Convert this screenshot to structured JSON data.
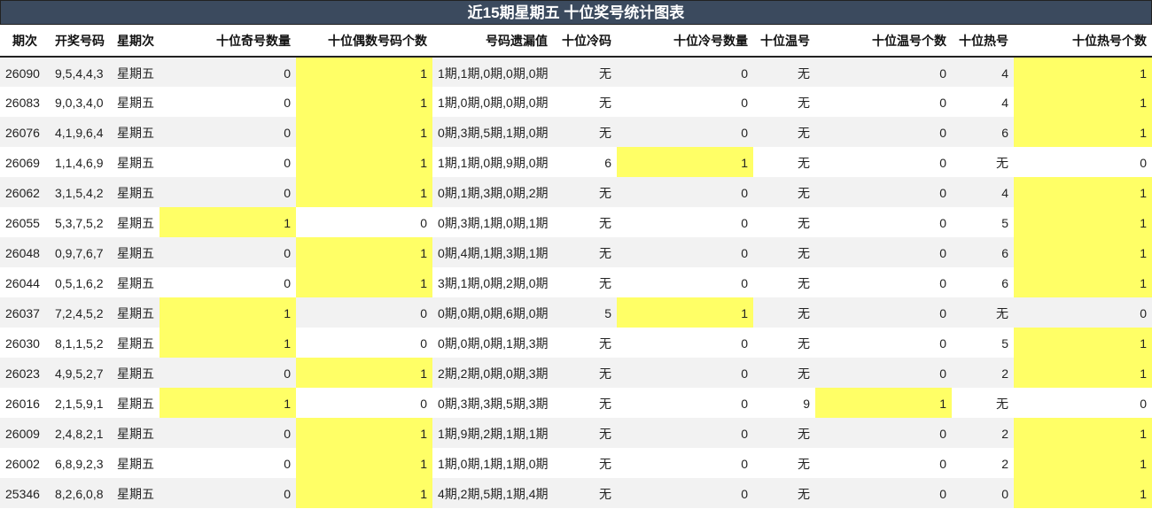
{
  "title": "近15期星期五 十位奖号统计图表",
  "headers": [
    "期次",
    "开奖号码",
    "星期次",
    "十位奇号数量",
    "十位偶数号码个数",
    "号码遗漏值",
    "十位冷码",
    "十位冷号数量",
    "十位温号",
    "十位温号个数",
    "十位热号",
    "十位热号个数"
  ],
  "highlight_color": "#ffff66",
  "rows": [
    {
      "issue": "26090",
      "numbers": "9,5,4,4,3",
      "weekday": "星期五",
      "odd_count": "0",
      "even_count": "1",
      "miss": "1期,1期,0期,0期,0期",
      "cold": "无",
      "cold_count": "0",
      "warm": "无",
      "warm_count": "0",
      "hot": "4",
      "hot_count": "1",
      "hl": [
        5,
        12
      ]
    },
    {
      "issue": "26083",
      "numbers": "9,0,3,4,0",
      "weekday": "星期五",
      "odd_count": "0",
      "even_count": "1",
      "miss": "1期,0期,0期,0期,0期",
      "cold": "无",
      "cold_count": "0",
      "warm": "无",
      "warm_count": "0",
      "hot": "4",
      "hot_count": "1",
      "hl": [
        5,
        12
      ]
    },
    {
      "issue": "26076",
      "numbers": "4,1,9,6,4",
      "weekday": "星期五",
      "odd_count": "0",
      "even_count": "1",
      "miss": "0期,3期,5期,1期,0期",
      "cold": "无",
      "cold_count": "0",
      "warm": "无",
      "warm_count": "0",
      "hot": "6",
      "hot_count": "1",
      "hl": [
        5,
        12
      ]
    },
    {
      "issue": "26069",
      "numbers": "1,1,4,6,9",
      "weekday": "星期五",
      "odd_count": "0",
      "even_count": "1",
      "miss": "1期,1期,0期,9期,0期",
      "cold": "6",
      "cold_count": "1",
      "warm": "无",
      "warm_count": "0",
      "hot": "无",
      "hot_count": "0",
      "hl": [
        5,
        8
      ]
    },
    {
      "issue": "26062",
      "numbers": "3,1,5,4,2",
      "weekday": "星期五",
      "odd_count": "0",
      "even_count": "1",
      "miss": "0期,1期,3期,0期,2期",
      "cold": "无",
      "cold_count": "0",
      "warm": "无",
      "warm_count": "0",
      "hot": "4",
      "hot_count": "1",
      "hl": [
        5,
        12
      ]
    },
    {
      "issue": "26055",
      "numbers": "5,3,7,5,2",
      "weekday": "星期五",
      "odd_count": "1",
      "even_count": "0",
      "miss": "0期,3期,1期,0期,1期",
      "cold": "无",
      "cold_count": "0",
      "warm": "无",
      "warm_count": "0",
      "hot": "5",
      "hot_count": "1",
      "hl": [
        4,
        12
      ]
    },
    {
      "issue": "26048",
      "numbers": "0,9,7,6,7",
      "weekday": "星期五",
      "odd_count": "0",
      "even_count": "1",
      "miss": "0期,4期,1期,3期,1期",
      "cold": "无",
      "cold_count": "0",
      "warm": "无",
      "warm_count": "0",
      "hot": "6",
      "hot_count": "1",
      "hl": [
        5,
        12
      ]
    },
    {
      "issue": "26044",
      "numbers": "0,5,1,6,2",
      "weekday": "星期五",
      "odd_count": "0",
      "even_count": "1",
      "miss": "3期,1期,0期,2期,0期",
      "cold": "无",
      "cold_count": "0",
      "warm": "无",
      "warm_count": "0",
      "hot": "6",
      "hot_count": "1",
      "hl": [
        5,
        12
      ]
    },
    {
      "issue": "26037",
      "numbers": "7,2,4,5,2",
      "weekday": "星期五",
      "odd_count": "1",
      "even_count": "0",
      "miss": "0期,0期,0期,6期,0期",
      "cold": "5",
      "cold_count": "1",
      "warm": "无",
      "warm_count": "0",
      "hot": "无",
      "hot_count": "0",
      "hl": [
        4,
        8
      ]
    },
    {
      "issue": "26030",
      "numbers": "8,1,1,5,2",
      "weekday": "星期五",
      "odd_count": "1",
      "even_count": "0",
      "miss": "0期,0期,0期,1期,3期",
      "cold": "无",
      "cold_count": "0",
      "warm": "无",
      "warm_count": "0",
      "hot": "5",
      "hot_count": "1",
      "hl": [
        4,
        12
      ]
    },
    {
      "issue": "26023",
      "numbers": "4,9,5,2,7",
      "weekday": "星期五",
      "odd_count": "0",
      "even_count": "1",
      "miss": "2期,2期,0期,0期,3期",
      "cold": "无",
      "cold_count": "0",
      "warm": "无",
      "warm_count": "0",
      "hot": "2",
      "hot_count": "1",
      "hl": [
        5,
        12
      ]
    },
    {
      "issue": "26016",
      "numbers": "2,1,5,9,1",
      "weekday": "星期五",
      "odd_count": "1",
      "even_count": "0",
      "miss": "0期,3期,3期,5期,3期",
      "cold": "无",
      "cold_count": "0",
      "warm": "9",
      "warm_count": "1",
      "hot": "无",
      "hot_count": "0",
      "hl": [
        4,
        10
      ]
    },
    {
      "issue": "26009",
      "numbers": "2,4,8,2,1",
      "weekday": "星期五",
      "odd_count": "0",
      "even_count": "1",
      "miss": "1期,9期,2期,1期,1期",
      "cold": "无",
      "cold_count": "0",
      "warm": "无",
      "warm_count": "0",
      "hot": "2",
      "hot_count": "1",
      "hl": [
        5,
        12
      ]
    },
    {
      "issue": "26002",
      "numbers": "6,8,9,2,3",
      "weekday": "星期五",
      "odd_count": "0",
      "even_count": "1",
      "miss": "1期,0期,1期,1期,0期",
      "cold": "无",
      "cold_count": "0",
      "warm": "无",
      "warm_count": "0",
      "hot": "2",
      "hot_count": "1",
      "hl": [
        5,
        12
      ]
    },
    {
      "issue": "25346",
      "numbers": "8,2,6,0,8",
      "weekday": "星期五",
      "odd_count": "0",
      "even_count": "1",
      "miss": "4期,2期,5期,1期,4期",
      "cold": "无",
      "cold_count": "0",
      "warm": "无",
      "warm_count": "0",
      "hot": "0",
      "hot_count": "1",
      "hl": [
        5,
        12
      ]
    }
  ]
}
